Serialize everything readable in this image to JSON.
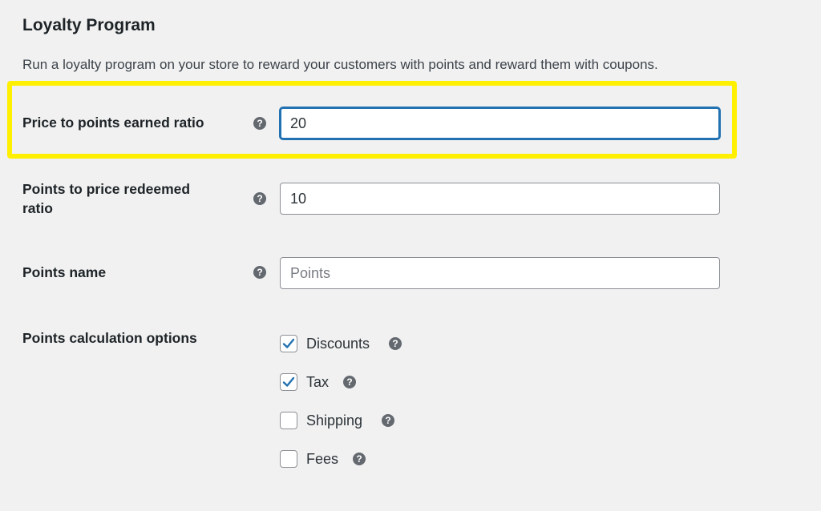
{
  "section": {
    "title": "Loyalty Program",
    "description": "Run a loyalty program on your store to reward your customers with points and reward them with coupons."
  },
  "fields": [
    {
      "label": "Price to points earned ratio",
      "value": "20",
      "placeholder": "",
      "focused": true,
      "highlighted": true
    },
    {
      "label_line1": "Points to price redeemed",
      "label_line2": "ratio",
      "value": "10",
      "placeholder": ""
    },
    {
      "label": "Points name",
      "value": "",
      "placeholder": "Points"
    }
  ],
  "calculation_options": {
    "label": "Points calculation options",
    "options": [
      {
        "label": "Discounts",
        "checked": true
      },
      {
        "label": "Tax",
        "checked": true
      },
      {
        "label": "Shipping",
        "checked": false
      },
      {
        "label": "Fees",
        "checked": false
      }
    ]
  },
  "icons": {
    "help": "help-icon",
    "check": "checkmark-icon"
  },
  "help_glyph": "?",
  "colors": {
    "highlight": "#ffef00",
    "focus": "#2271b1",
    "check": "#2271b1",
    "background": "#f1f1f1"
  }
}
